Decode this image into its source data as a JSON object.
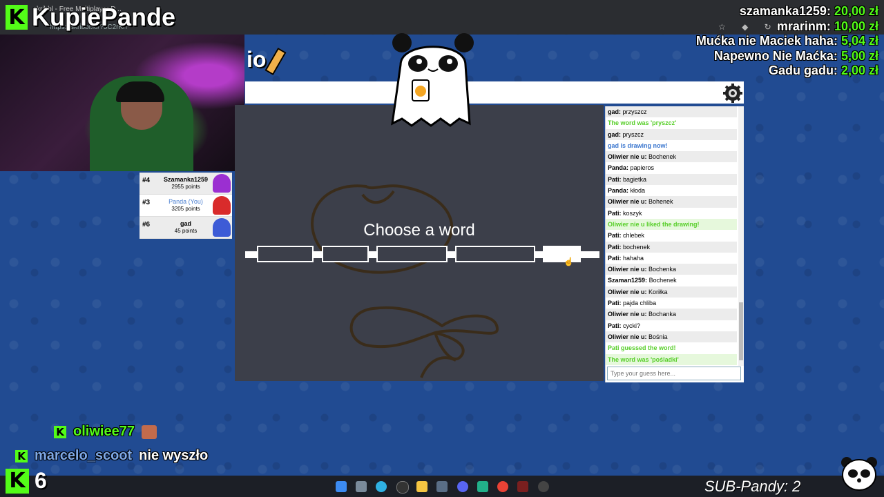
{
  "browser": {
    "tab_title": "skribbl - Free Multiplayer D...",
    "url": "https://skribbl.io/?5C2rKrf"
  },
  "stream": {
    "channel_name": "KupiePande",
    "viewer_count": "6",
    "sub_goal": "SUB-Pandy: 2",
    "kick_green": "#53fc18"
  },
  "donations": [
    {
      "name": "szamanka1259:",
      "amount": "20,00 zł"
    },
    {
      "name": "mrarinm:",
      "amount": "10,00 zł"
    },
    {
      "name": "Mućka nie Maciek haha:",
      "amount": "5,04 zł"
    },
    {
      "name": "Napewno Nie Maćka:",
      "amount": "5,00 zł"
    },
    {
      "name": "Gadu gadu:",
      "amount": "2,00 zł"
    }
  ],
  "game": {
    "logo_suffix": "io",
    "choose_title": "Choose a word",
    "chat_placeholder": "Type your guess here...",
    "players": [
      {
        "rank": "#4",
        "name": "Szamanka1259",
        "points": "2955 points",
        "avatar_color": "#9b2fd1",
        "you": false
      },
      {
        "rank": "#3",
        "name": "Panda (You)",
        "points": "3205 points",
        "avatar_color": "#d92b2b",
        "you": true
      },
      {
        "rank": "#6",
        "name": "gad",
        "points": "45 points",
        "avatar_color": "#3d5bd6",
        "you": false
      }
    ],
    "chat": [
      {
        "user": "gad:",
        "text": "przyszcz",
        "style": "normal"
      },
      {
        "user": "",
        "text": "The word was 'pryszcz'",
        "style": "green"
      },
      {
        "user": "gad:",
        "text": "pryszcz",
        "style": "normal"
      },
      {
        "user": "",
        "text": "gad is drawing now!",
        "style": "blue"
      },
      {
        "user": "Oliwier nie u:",
        "text": "Bochenek",
        "style": "normal"
      },
      {
        "user": "Panda:",
        "text": "papieros",
        "style": "normal"
      },
      {
        "user": "Pati:",
        "text": "bagietka",
        "style": "normal"
      },
      {
        "user": "Panda:",
        "text": "kłoda",
        "style": "normal"
      },
      {
        "user": "Oliwier nie u:",
        "text": "Bohenek",
        "style": "normal"
      },
      {
        "user": "Pati:",
        "text": "koszyk",
        "style": "normal"
      },
      {
        "user": "",
        "text": "Oliwier nie u liked the drawing!",
        "style": "green"
      },
      {
        "user": "Pati:",
        "text": "chlebek",
        "style": "normal"
      },
      {
        "user": "Pati:",
        "text": "bochenek",
        "style": "normal"
      },
      {
        "user": "Pati:",
        "text": "hahaha",
        "style": "normal"
      },
      {
        "user": "Oliwier nie u:",
        "text": "Bochenka",
        "style": "normal"
      },
      {
        "user": "Szaman1259:",
        "text": "Bochenek",
        "style": "normal"
      },
      {
        "user": "Oliwier nie u:",
        "text": "Koriłka",
        "style": "normal"
      },
      {
        "user": "Pati:",
        "text": "pajda chliba",
        "style": "normal"
      },
      {
        "user": "Oliwier nie u:",
        "text": "Bochanka",
        "style": "normal"
      },
      {
        "user": "Pati:",
        "text": "cycki?",
        "style": "normal"
      },
      {
        "user": "Oliwier nie u:",
        "text": "Bośnia",
        "style": "normal"
      },
      {
        "user": "",
        "text": "Pati guessed the word!",
        "style": "green"
      },
      {
        "user": "",
        "text": "The word was 'pośladki'",
        "style": "green"
      }
    ]
  },
  "stream_chat": [
    {
      "user": "oliwiee77",
      "text": ""
    },
    {
      "user": "marcelo_scoot",
      "text": "nie wyszło"
    }
  ]
}
